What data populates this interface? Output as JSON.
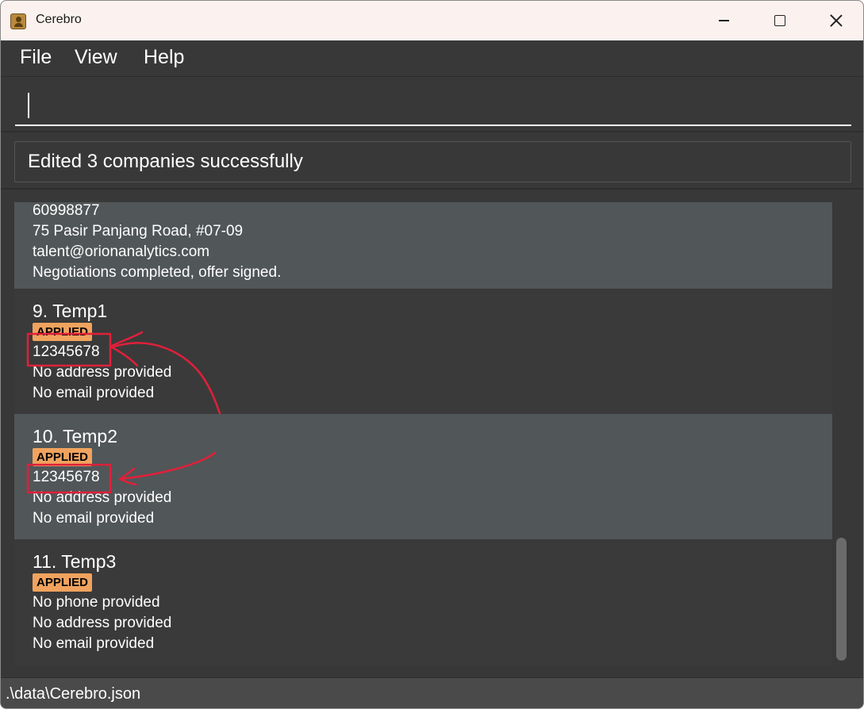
{
  "window": {
    "title": "Cerebro",
    "icon": "address-book-icon"
  },
  "window_controls": {
    "minimize": "minimize-icon",
    "maximize": "maximize-icon",
    "close": "close-icon"
  },
  "menu": {
    "file": "File",
    "view": "View",
    "help": "Help"
  },
  "command_box": {
    "value": ""
  },
  "result_display": {
    "message": "Edited 3 companies successfully"
  },
  "companies": {
    "c8": {
      "phone": "60998877",
      "address": "75 Pasir Panjang Road, #07-09",
      "email": "talent@orionanalytics.com",
      "remark": "Negotiations completed, offer signed."
    },
    "c9": {
      "title": "9. Temp1",
      "tag": "APPLIED",
      "phone": "12345678",
      "address": "No address provided",
      "email": "No email provided"
    },
    "c10": {
      "title": "10. Temp2",
      "tag": "APPLIED",
      "phone": "12345678",
      "address": "No address provided",
      "email": "No email provided"
    },
    "c11": {
      "title": "11. Temp3",
      "tag": "APPLIED",
      "phone": "No phone provided",
      "address": "No address provided",
      "email": "No email provided"
    }
  },
  "status_bar": {
    "path": ".\\data\\Cerebro.json"
  },
  "colors": {
    "background": "#383838",
    "card_light": "#515658",
    "card_dark": "#3a3a3a",
    "tag": "#f0a35e",
    "annotation": "#e0203a"
  }
}
